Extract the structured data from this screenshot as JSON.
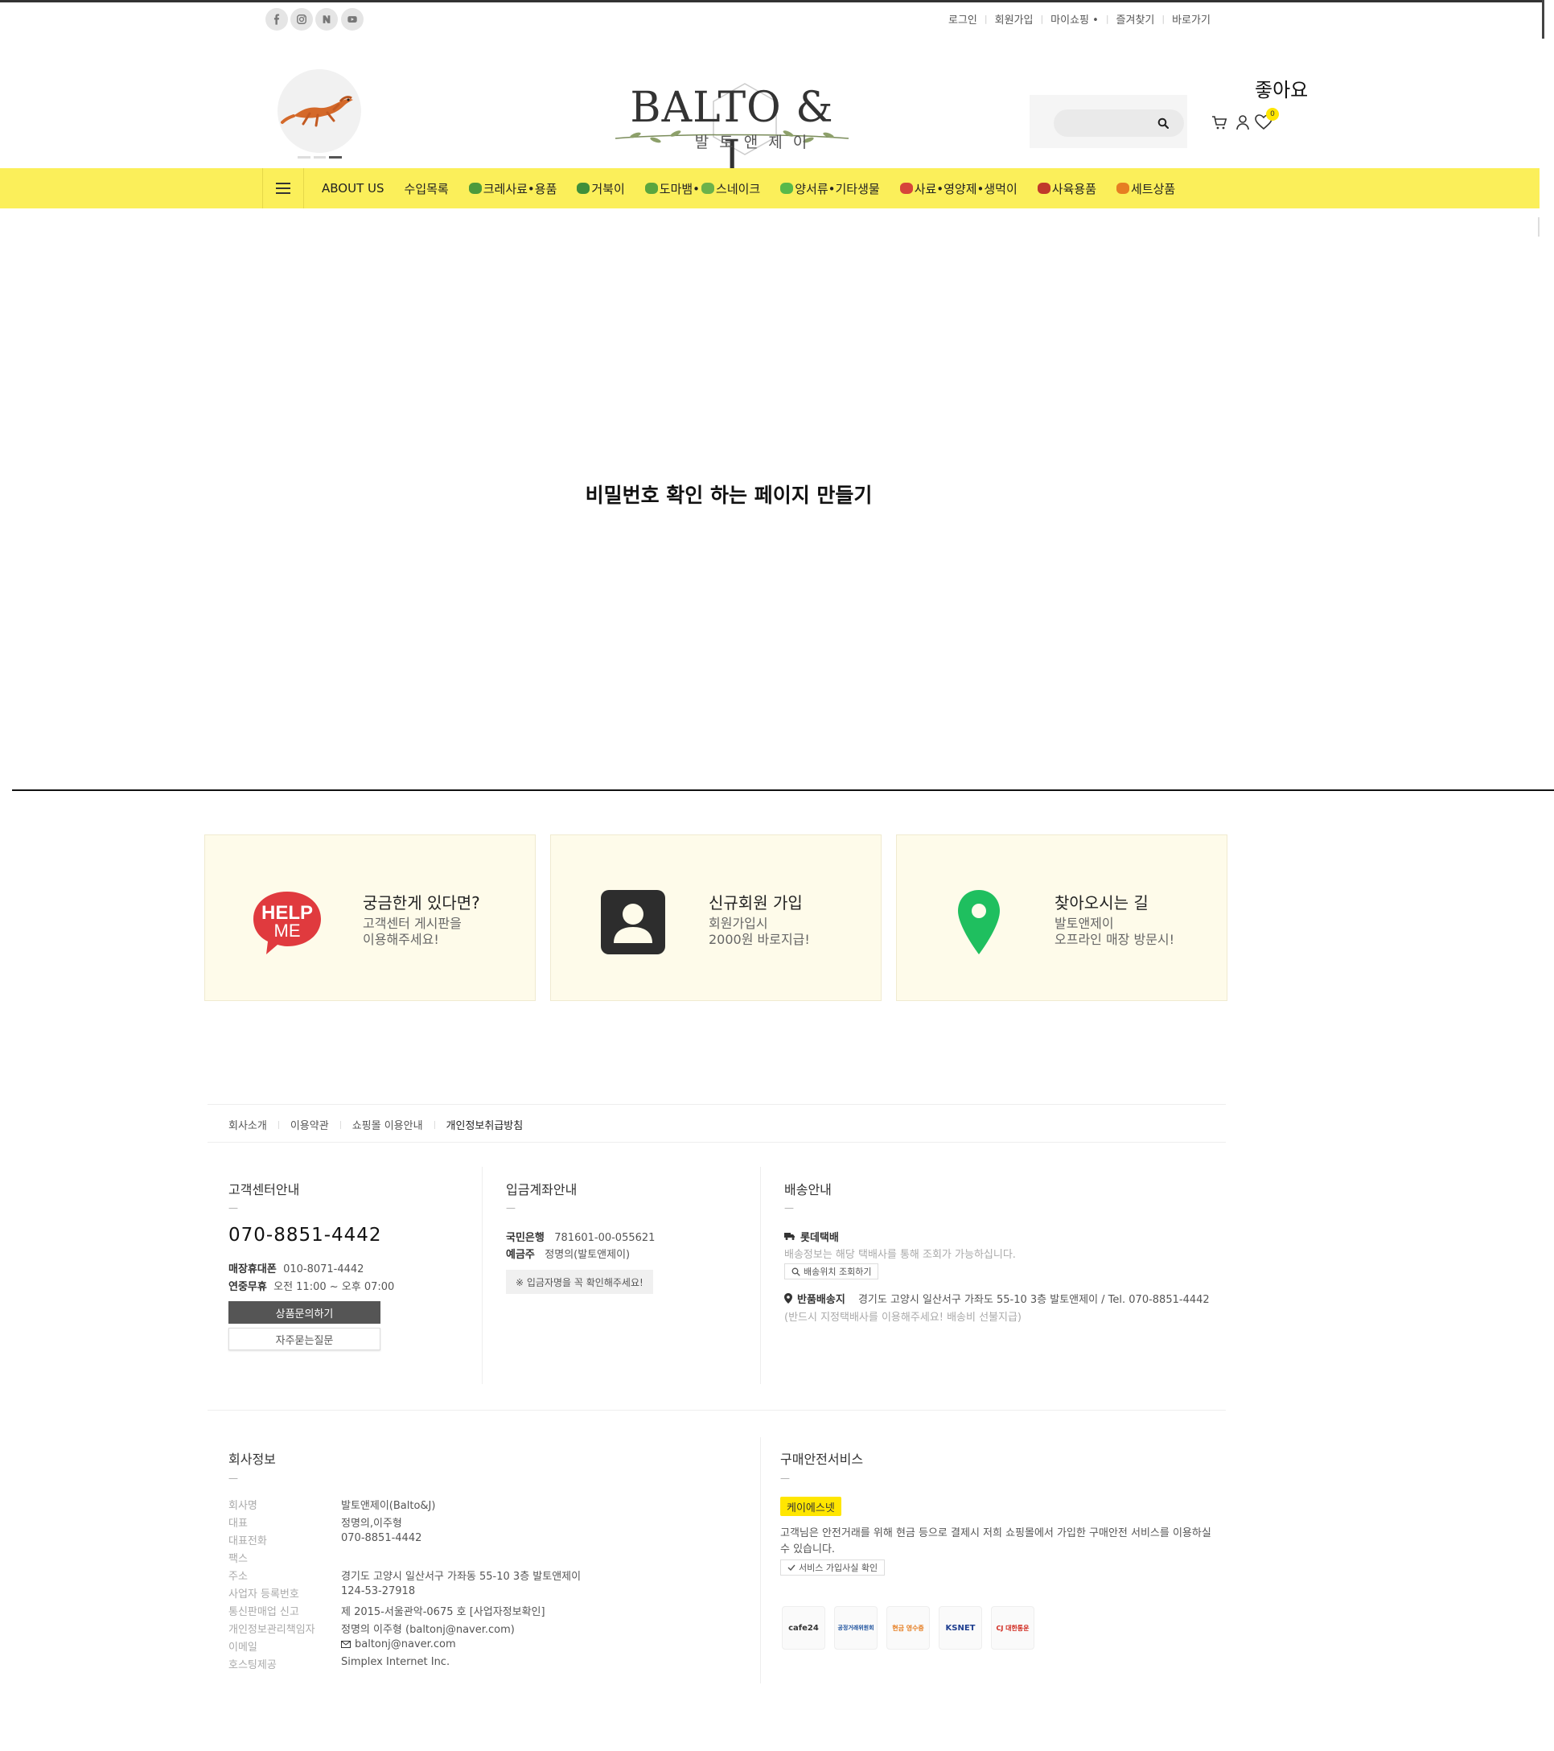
{
  "top_bar": {
    "social_icons": [
      "facebook-icon",
      "instagram-icon",
      "naver-icon",
      "youtube-icon"
    ],
    "menu": [
      "로그인",
      "회원가입",
      "마이쇼핑 •",
      "즐겨찾기",
      "바로가기"
    ]
  },
  "header": {
    "brand_name": "BALTO & J",
    "brand_sub": "발토앤제이",
    "like_text": "좋아요",
    "search_placeholder": "",
    "wishlist_count": "0"
  },
  "nav": {
    "items": [
      {
        "label": "ABOUT US",
        "icon": ""
      },
      {
        "label": "수입목록",
        "icon": ""
      },
      {
        "label": "크레사료•용품",
        "icon": "gecko-emoji"
      },
      {
        "label": "거북이",
        "icon": "turtle-emoji"
      },
      {
        "label": "도마뱀•",
        "icon": "lizard-emoji"
      },
      {
        "label": "스네이크",
        "icon": "snake-emoji"
      },
      {
        "label": "양서류•기타생물",
        "icon": "frog-emoji"
      },
      {
        "label": "사료•영양제•생먹이",
        "icon": "feed-emoji"
      },
      {
        "label": "사육용품",
        "icon": "toolbox-emoji"
      },
      {
        "label": "세트상품",
        "icon": "gift-emoji"
      }
    ]
  },
  "main": {
    "title": "비밀번호 확인 하는 페이지 만들기"
  },
  "cards": [
    {
      "title": "궁금한게 있다면?",
      "desc1": "고객센터 게시판을",
      "desc2": "이용해주세요!",
      "icon": "help-me-icon"
    },
    {
      "title": "신규회원 가입",
      "desc1": "회원가입시",
      "desc2": "2000원 바로지급!",
      "icon": "user-card-icon"
    },
    {
      "title": "찾아오시는 길",
      "desc1": "발토앤제이",
      "desc2": "오프라인 매장 방문시!",
      "icon": "map-pin-icon"
    }
  ],
  "footer": {
    "links": [
      "회사소개",
      "이용약관",
      "쇼핑몰 이용안내",
      "개인정보취급방침"
    ],
    "cs": {
      "title": "고객센터안내",
      "dash": "—",
      "phone": "070-8851-4442",
      "store_phone_label": "매장휴대폰",
      "store_phone": "010-8071-4442",
      "hours_label": "연중무휴",
      "hours": "오전 11:00 ~ 오후 07:00",
      "btn_inquiry": "상품문의하기",
      "btn_faq": "자주묻는질문"
    },
    "bank": {
      "title": "입금계좌안내",
      "dash": "—",
      "bank_name": "국민은행",
      "account": "781601-00-055621",
      "holder_label": "예금주",
      "holder": "정명의(발토앤제이)",
      "notice": "※ 입금자명을 꼭 확인해주세요!"
    },
    "shipping": {
      "title": "배송안내",
      "dash": "—",
      "courier": "롯데택배",
      "courier_desc": "배송정보는 해당 택배사를 통해 조회가 가능하십니다.",
      "track_btn": "배송위치 조회하기",
      "return_label": "반품배송지",
      "return_addr": "경기도 고양시 일산서구 가좌도 55-10 3층 발토앤제이 / Tel. 070-8851-4442",
      "return_note": "(반드시 지정택배사를 이용해주세요! 배송비 선불지급)"
    },
    "company": {
      "title": "회사정보",
      "dash": "—",
      "rows": [
        {
          "label": "회사명",
          "value": "발토앤제이(Balto&J)"
        },
        {
          "label": "대표",
          "value": "정명의,이주형"
        },
        {
          "label": "대표전화",
          "value": "070-8851-4442"
        },
        {
          "label": "팩스",
          "value": ""
        },
        {
          "label": "주소",
          "value": "경기도 고양시 일산서구 가좌동 55-10 3층 발토앤제이"
        },
        {
          "label": "사업자 등록번호",
          "value": "124-53-27918"
        },
        {
          "label": "통신판매업 신고",
          "value": "제 2015-서울관악-0675 호  [사업자정보확인]"
        },
        {
          "label": "개인정보관리책임자",
          "value": "정명의 이주형 (baltonj@naver.com)"
        },
        {
          "label": "이메일",
          "value": "baltonj@naver.com"
        },
        {
          "label": "호스팅제공",
          "value": "Simplex Internet Inc."
        }
      ]
    },
    "escrow": {
      "title": "구매안전서비스",
      "dash": "—",
      "badge": "케이에스넷",
      "desc1": "고객님은 안전거래를 위해 현금 등으로 결제시 저희 쇼핑몰에서 가입한 구매안전 서비스를 이용하실",
      "desc2": "수 있습니다.",
      "verify_btn": "서비스 가입사실 확인",
      "partners": [
        "cafe24",
        "공정거래위원회",
        "현금 영수증",
        "KSNET",
        "CJ 대한통운"
      ]
    }
  },
  "colors": {
    "nav_bg": "#fbef5a",
    "card_bg": "#fefbea",
    "help_red": "#e03a3e",
    "pin_green": "#1fbf5f",
    "badge_yellow": "#ffe600"
  }
}
